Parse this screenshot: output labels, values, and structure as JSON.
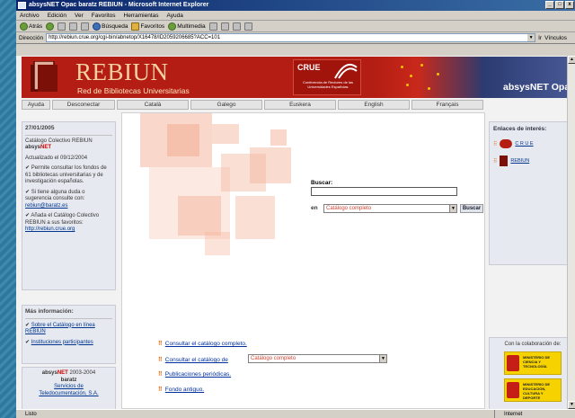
{
  "window": {
    "title": "absysNET Opac baratz REBIUN - Microsoft Internet Explorer",
    "controls": [
      "_",
      "□",
      "x"
    ]
  },
  "menu": [
    "Archivo",
    "Edición",
    "Ver",
    "Favoritos",
    "Herramientas",
    "Ayuda"
  ],
  "toolbar": {
    "back": "Atrás",
    "search": "Búsqueda",
    "favorites": "Favoritos",
    "multimedia": "Multimedia"
  },
  "address": {
    "label": "Dirección",
    "url": "http://rebiun.crue.org/cgi-bin/abnetop/X16478/ID2059206685?ACC=101",
    "go": "Ir",
    "links": "Vínculos"
  },
  "banner": {
    "title": "REBIUN",
    "subtitle": "Red de Bibliotecas Universitarias",
    "crue": "CRUE",
    "crue_sub": "Conferencia de Rectores de las Universidades Españolas",
    "absys": "absysNET Opac"
  },
  "nav": [
    "Ayuda",
    "Desconectar",
    "Català",
    "Galego",
    "Euskera",
    "English",
    "Français"
  ],
  "left": {
    "date": "27/01/2005",
    "cat_line1": "Catálogo Colectivo REBIUN",
    "cat_line2a": "absys",
    "cat_line2b": "NET",
    "updated": "Actualizado el 09/12/2004",
    "bullet1": "✔ Permite consultar los fondos de 61 bibliotecas universitarias y de investigación españolas.",
    "bullet2": "✔ Si tiene alguna duda o sugerencia consulte con:",
    "email": "rebiun@baratz.es",
    "bullet3": "✔ Añada el Catálogo Colectivo REBIUN a sus favoritos:",
    "url": "http://rebiun.crue.org",
    "more_info": "Más información:",
    "info1": "Sobre el Catálogo en línea REBIUN",
    "info2": "Instituciones participantes",
    "footer_a": "absys",
    "footer_b": "NET",
    "footer_c": " 2003-2004",
    "footer_d": "baratz",
    "footer_e": "Servicios de",
    "footer_f": "Teledocumentación, S.A."
  },
  "search": {
    "label": "Buscar:",
    "en": "en",
    "catalog": "Catálogo completo",
    "button": "Buscar"
  },
  "links": {
    "l1": "Consultar el catálogo completo.",
    "l2": "Consultar el catálogo de",
    "l2_select": "Catálogo completo",
    "l3": "Publicaciones periódicas.",
    "l4": "Fondo antiguo."
  },
  "right": {
    "heading": "Enlaces de interés:",
    "link1": "C R U E",
    "link2": "REBIUN",
    "colab": "Con la colaboración de:",
    "min1": "MINISTERIO DE CIENCIA Y TECNOLOGÍA",
    "min2": "MINISTERIO DE EDUCACIÓN, CULTURA Y DEPORTE"
  },
  "status": {
    "left": "Listo",
    "right": "Internet"
  }
}
